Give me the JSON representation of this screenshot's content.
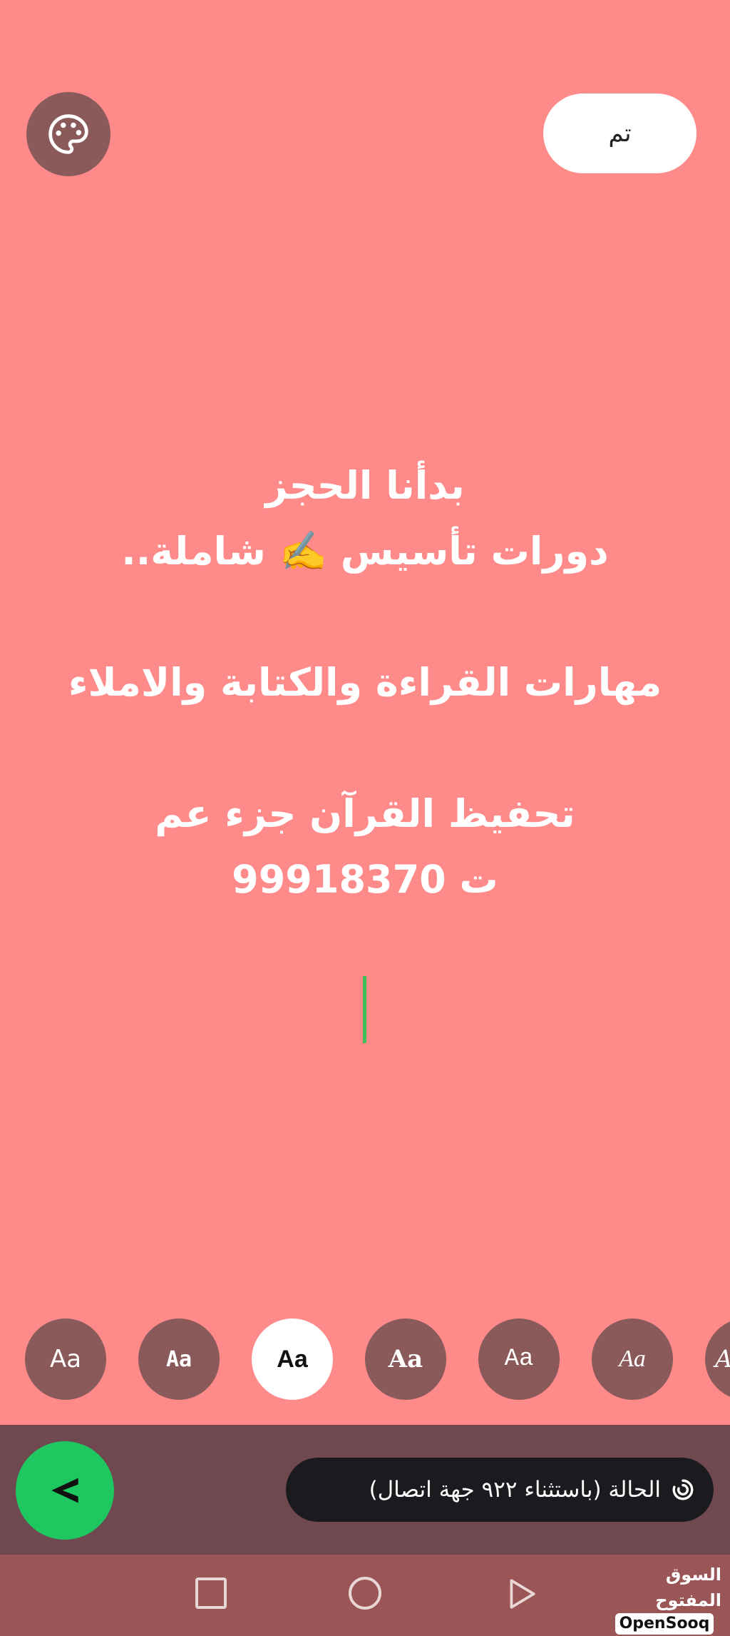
{
  "header": {
    "palette_icon": "palette-icon",
    "done_label": "تم"
  },
  "status_text": {
    "lines": [
      "بدأنا الحجز",
      "دورات تأسيس ✍️ شاملة..",
      "",
      "مهارات القراءة والكتابة والاملاء",
      "",
      "تحفيظ القرآن جزء عم",
      "ت 99918370"
    ],
    "text_color": "#ffffff",
    "background_color": "#ff8a8a",
    "cursor_color": "#3fbf57"
  },
  "font_options": [
    {
      "label": "Aa",
      "selected": false
    },
    {
      "label": "Aa",
      "selected": false
    },
    {
      "label": "Aa",
      "selected": true
    },
    {
      "label": "Aa",
      "selected": false
    },
    {
      "label": "Aa",
      "selected": false
    },
    {
      "label": "Aa",
      "selected": false
    },
    {
      "label": "A",
      "selected": false
    }
  ],
  "composer": {
    "audience_label": "الحالة (باستثناء ٩٢٢ جهة اتصال)",
    "audience_icon": "status-ring-icon",
    "send_icon": "send-arrow-icon",
    "send_color": "#1ec760"
  },
  "nav": {
    "recents_icon": "square-icon",
    "home_icon": "circle-icon",
    "back_icon": "triangle-back-icon"
  },
  "watermark": {
    "arabic": "السوق المفتوح",
    "english": "OpenSooq"
  }
}
